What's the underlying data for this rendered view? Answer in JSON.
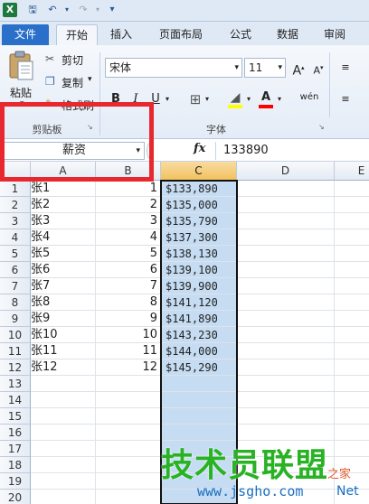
{
  "qat": {
    "icons": [
      "excel-logo-icon",
      "save-icon",
      "undo-icon",
      "redo-icon",
      "customize-qat-icon"
    ]
  },
  "tabs": [
    "文件",
    "开始",
    "插入",
    "页面布局",
    "公式",
    "数据",
    "审阅"
  ],
  "ribbon": {
    "clipboard": {
      "paste_label": "粘贴",
      "cut_label": "剪切",
      "copy_label": "复制",
      "format_painter_label": "格式刷",
      "group_label": "剪贴板"
    },
    "font": {
      "font_name": "宋体",
      "font_size": "11",
      "bold_label": "B",
      "italic_label": "I",
      "underline_label": "U",
      "phonetic_label": "wén",
      "group_label": "字体",
      "highlight_color": "#ffff00",
      "font_color": "#ff0000"
    }
  },
  "formula_bar": {
    "name_box": "薪资",
    "fx_label": "fx",
    "value": "133890"
  },
  "sheet": {
    "columns": [
      "A",
      "B",
      "C",
      "D",
      "E"
    ],
    "selected_column": "C",
    "row_numbers": [
      "1",
      "2",
      "3",
      "4",
      "5",
      "6",
      "7",
      "8",
      "9",
      "10",
      "11",
      "12",
      "13",
      "14",
      "15",
      "16",
      "17",
      "18",
      "19",
      "20"
    ],
    "rows": [
      {
        "a": "张1",
        "b": "1",
        "c": "$133,890"
      },
      {
        "a": "张2",
        "b": "2",
        "c": "$135,000"
      },
      {
        "a": "张3",
        "b": "3",
        "c": "$135,790"
      },
      {
        "a": "张4",
        "b": "4",
        "c": "$137,300"
      },
      {
        "a": "张5",
        "b": "5",
        "c": "$138,130"
      },
      {
        "a": "张6",
        "b": "6",
        "c": "$139,100"
      },
      {
        "a": "张7",
        "b": "7",
        "c": "$139,900"
      },
      {
        "a": "张8",
        "b": "8",
        "c": "$141,120"
      },
      {
        "a": "张9",
        "b": "9",
        "c": "$141,890"
      },
      {
        "a": "张10",
        "b": "10",
        "c": "$143,230"
      },
      {
        "a": "张11",
        "b": "11",
        "c": "$144,000"
      },
      {
        "a": "张12",
        "b": "12",
        "c": "$145,290"
      }
    ]
  },
  "watermark": {
    "text": "技术员联盟",
    "url": "www.jsgho.com",
    "extra1": "之家",
    "extra2": "Net"
  },
  "colors": {
    "accent": "#2a6fc9",
    "selection_fill": "#c5dcf2",
    "highlight_box": "#e8272e",
    "watermark": "#29b224"
  }
}
